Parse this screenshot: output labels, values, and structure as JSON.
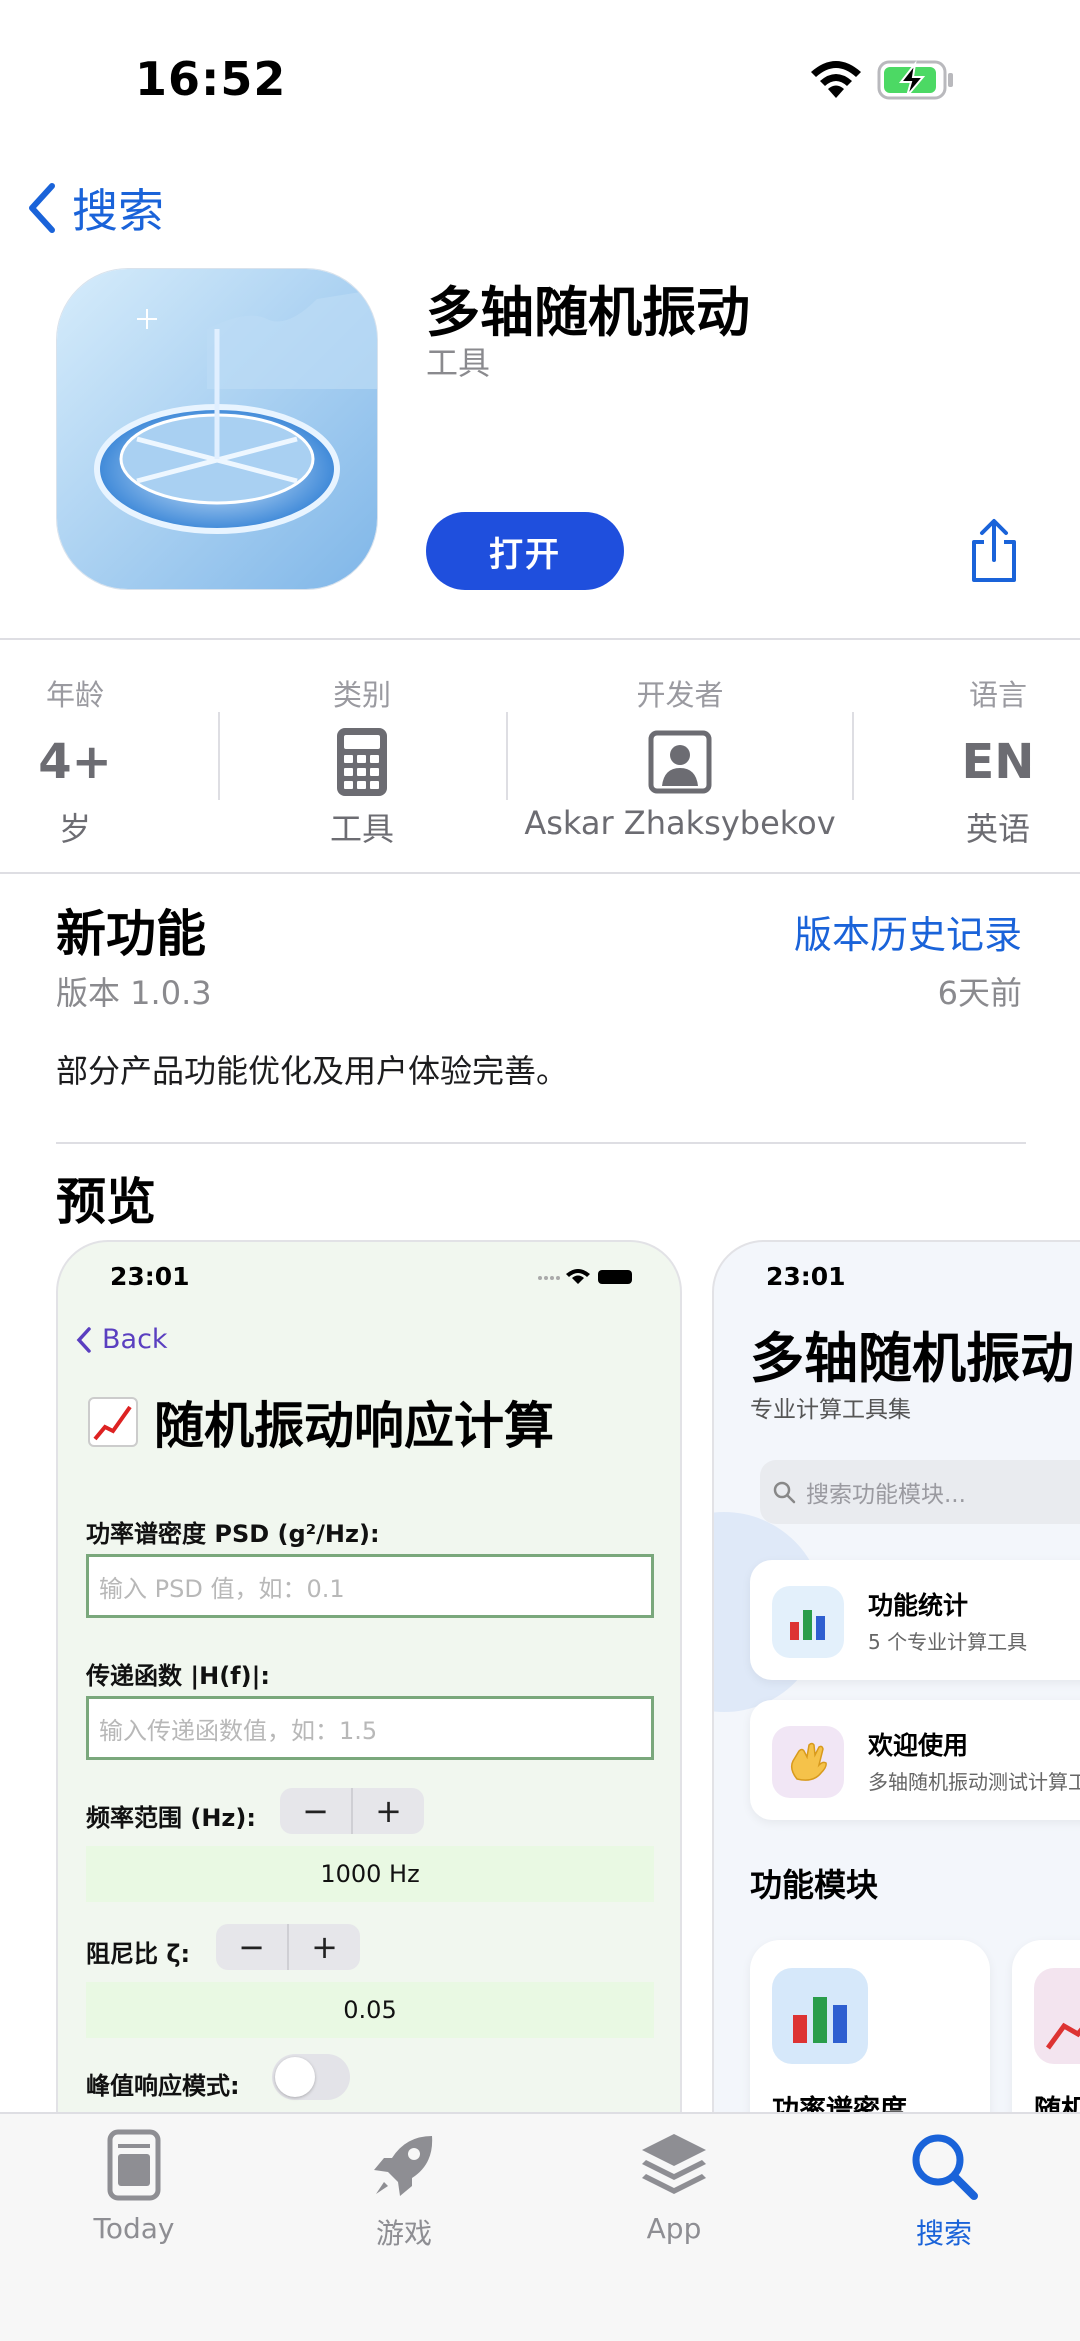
{
  "status": {
    "time": "16:52"
  },
  "nav": {
    "back_label": "搜索"
  },
  "app": {
    "name": "多轴随机振动",
    "category": "工具",
    "open_label": "打开"
  },
  "info": {
    "age": {
      "head": "年龄",
      "value": "4+",
      "sub": "岁"
    },
    "category": {
      "head": "类别",
      "sub": "工具"
    },
    "developer": {
      "head": "开发者",
      "sub": "Askar Zhaksybekov"
    },
    "language": {
      "head": "语言",
      "value": "EN",
      "sub": "英语"
    }
  },
  "whats_new": {
    "title": "新功能",
    "history_link": "版本历史记录",
    "version": "版本 1.0.3",
    "time_ago": "6天前",
    "notes": "部分产品功能优化及用户体验完善。"
  },
  "preview": {
    "title": "预览",
    "shot1": {
      "time": "23:01",
      "back": "Back",
      "title": "随机振动响应计算",
      "psd_label": "功率谱密度 PSD (g²/Hz):",
      "psd_placeholder": "输入 PSD 值，如：0.1",
      "tf_label": "传递函数 |H(f)|:",
      "tf_placeholder": "输入传递函数值，如：1.5",
      "freq_label": "频率范围 (Hz):",
      "freq_value": "1000 Hz",
      "damping_label": "阻尼比 ζ:",
      "damping_value": "0.05",
      "peak_label": "峰值响应模式:",
      "minus": "−",
      "plus": "+"
    },
    "shot2": {
      "time": "23:01",
      "title": "多轴随机振动",
      "subtitle": "专业计算工具集",
      "search_placeholder": "搜索功能模块...",
      "card1_title": "功能统计",
      "card1_sub": "5 个专业计算工具",
      "card2_title": "欢迎使用",
      "card2_sub": "多轴随机振动测试计算工",
      "section": "功能模块",
      "module1": "功率谱密度",
      "module2": "随机"
    }
  },
  "tabs": [
    {
      "label": "Today"
    },
    {
      "label": "游戏"
    },
    {
      "label": "App"
    },
    {
      "label": "搜索"
    }
  ],
  "colors": {
    "accent": "#1a63d9",
    "button": "#1f4fdd"
  }
}
